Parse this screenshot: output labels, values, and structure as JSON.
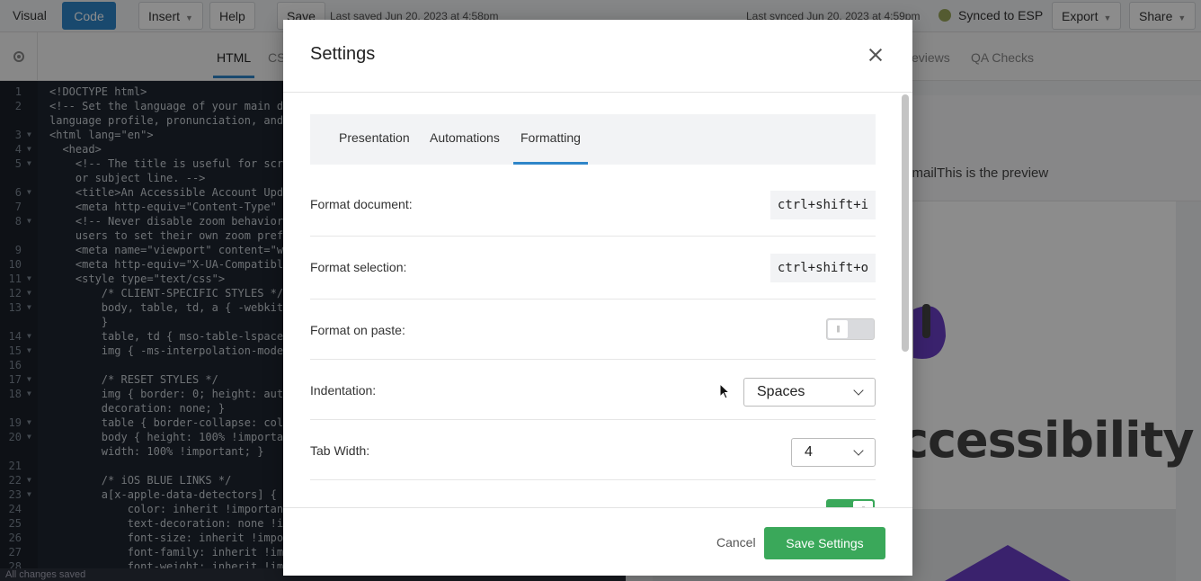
{
  "toolbar": {
    "visual_label": "Visual",
    "code_label": "Code",
    "insert_label": "Insert",
    "help_label": "Help",
    "save_label": "Save",
    "last_saved": "Last saved Jun 20, 2023 at 4:58pm",
    "last_synced": "Last synced Jun 20, 2023 at 4:59pm",
    "synced_label": "Synced to ESP",
    "export_label": "Export",
    "share_label": "Share"
  },
  "subbar": {
    "tabs": [
      "HTML",
      "CSS"
    ],
    "right_tabs": [
      "eviews",
      "QA Checks"
    ]
  },
  "editor": {
    "status": "All changes saved",
    "lines": [
      {
        "n": "1",
        "fold": "",
        "text": "<!DOCTYPE html>"
      },
      {
        "n": "2",
        "fold": "",
        "text": "<!-- Set the language of your main d"
      },
      {
        "n": "",
        "fold": "",
        "text": "language profile, pronunciation, and"
      },
      {
        "n": "3",
        "fold": "▼",
        "text": "<html lang=\"en\">"
      },
      {
        "n": "4",
        "fold": "▼",
        "text": "  <head>"
      },
      {
        "n": "5",
        "fold": "▼",
        "text": "    <!-- The title is useful for scr"
      },
      {
        "n": "",
        "fold": "",
        "text": "    or subject line. -->"
      },
      {
        "n": "6",
        "fold": "▼",
        "text": "    <title>An Accessible Account Upd"
      },
      {
        "n": "7",
        "fold": "",
        "text": "    <meta http-equiv=\"Content-Type\""
      },
      {
        "n": "8",
        "fold": "▼",
        "text": "    <!-- Never disable zoom behavior"
      },
      {
        "n": "",
        "fold": "",
        "text": "    users to set their own zoom pref"
      },
      {
        "n": "9",
        "fold": "",
        "text": "    <meta name=\"viewport\" content=\"w"
      },
      {
        "n": "10",
        "fold": "",
        "text": "    <meta http-equiv=\"X-UA-Compatibl"
      },
      {
        "n": "11",
        "fold": "▼",
        "text": "    <style type=\"text/css\">"
      },
      {
        "n": "12",
        "fold": "▼",
        "text": "        /* CLIENT-SPECIFIC STYLES */"
      },
      {
        "n": "13",
        "fold": "▼",
        "text": "        body, table, td, a { -webkit"
      },
      {
        "n": "",
        "fold": "",
        "text": "        }"
      },
      {
        "n": "14",
        "fold": "▼",
        "text": "        table, td { mso-table-lspace"
      },
      {
        "n": "15",
        "fold": "▼",
        "text": "        img { -ms-interpolation-mode"
      },
      {
        "n": "16",
        "fold": "",
        "text": ""
      },
      {
        "n": "17",
        "fold": "▼",
        "text": "        /* RESET STYLES */"
      },
      {
        "n": "18",
        "fold": "▼",
        "text": "        img { border: 0; height: auto"
      },
      {
        "n": "",
        "fold": "",
        "text": "        decoration: none; }"
      },
      {
        "n": "19",
        "fold": "▼",
        "text": "        table { border-collapse: col"
      },
      {
        "n": "20",
        "fold": "▼",
        "text": "        body { height: 100% !importa"
      },
      {
        "n": "",
        "fold": "",
        "text": "        width: 100% !important; }"
      },
      {
        "n": "21",
        "fold": "",
        "text": ""
      },
      {
        "n": "22",
        "fold": "▼",
        "text": "        /* iOS BLUE LINKS */"
      },
      {
        "n": "23",
        "fold": "▼",
        "text": "        a[x-apple-data-detectors] {"
      },
      {
        "n": "24",
        "fold": "",
        "text": "            color: inherit !importan"
      },
      {
        "n": "25",
        "fold": "",
        "text": "            text-decoration: none !i"
      },
      {
        "n": "26",
        "fold": "",
        "text": "            font-size: inherit !impo"
      },
      {
        "n": "27",
        "fold": "",
        "text": "            font-family: inherit !im"
      },
      {
        "n": "28",
        "fold": "",
        "text": "            font-weight: inherit !im"
      }
    ]
  },
  "preview": {
    "header_text": "e EmailThis is the preview",
    "title_text": "ccessibility",
    "colors": {
      "accent": "#6a3fc7"
    }
  },
  "modal": {
    "title": "Settings",
    "tabs": [
      "Presentation",
      "Automations",
      "Formatting"
    ],
    "active_tab": "Formatting",
    "rows": {
      "format_document": {
        "label": "Format document:",
        "shortcut": "ctrl+shift+i"
      },
      "format_selection": {
        "label": "Format selection:",
        "shortcut": "ctrl+shift+o"
      },
      "format_on_paste": {
        "label": "Format on paste:",
        "enabled": false
      },
      "indentation": {
        "label": "Indentation:",
        "value": "Spaces"
      },
      "tab_width": {
        "label": "Tab Width:",
        "value": "4"
      },
      "next_toggle": {
        "enabled": true
      }
    },
    "cancel_label": "Cancel",
    "save_label": "Save Settings"
  },
  "colors": {
    "primary": "#2f86c9",
    "success": "#3aa85a"
  }
}
